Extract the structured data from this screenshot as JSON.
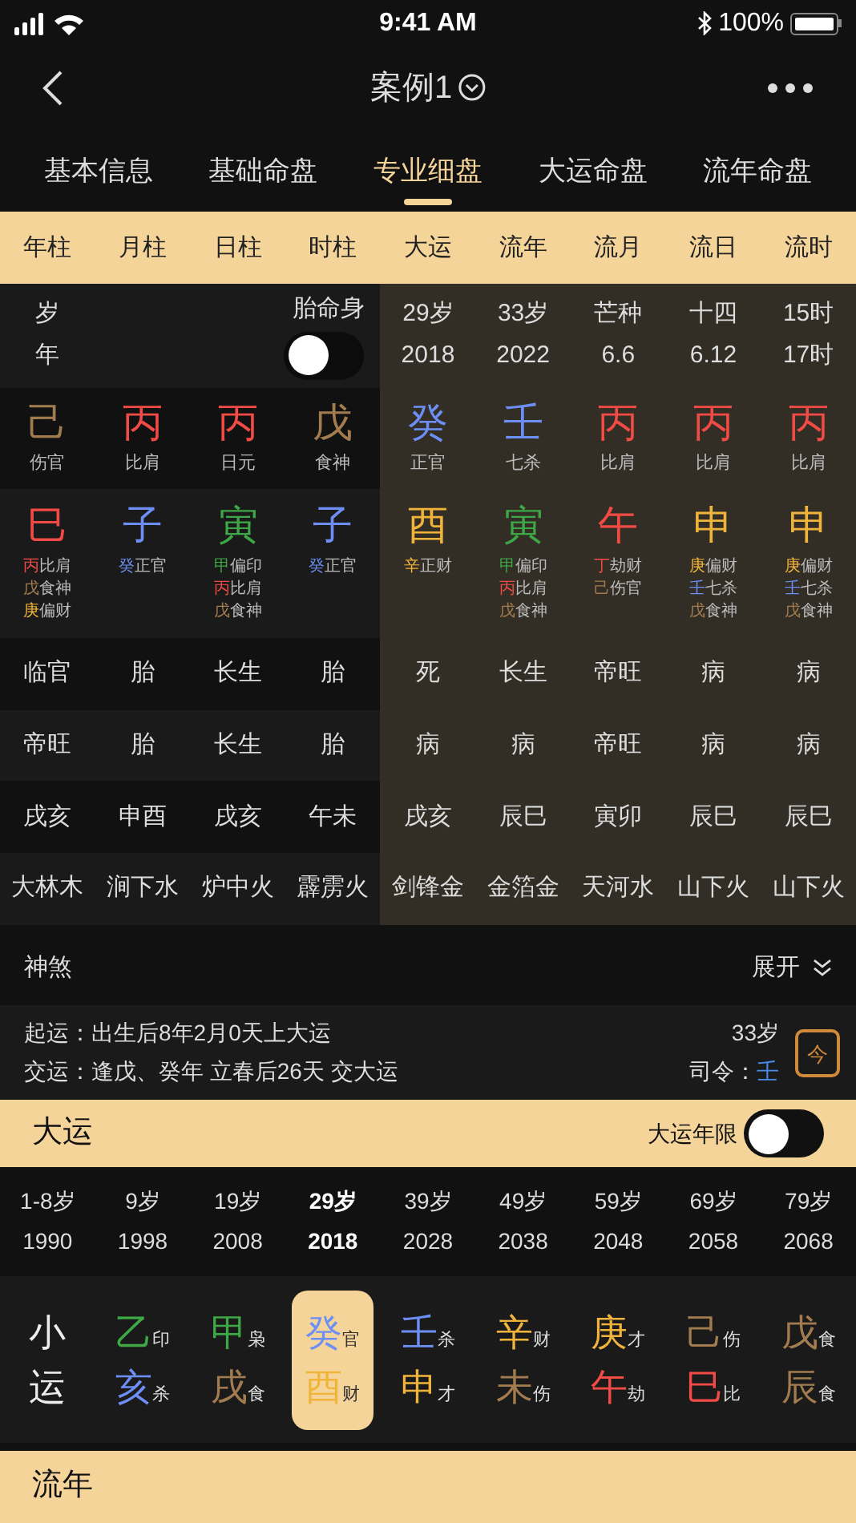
{
  "status_bar": {
    "time": "9:41 AM",
    "battery": "100%"
  },
  "nav": {
    "title": "案例1"
  },
  "tabs": [
    {
      "label": "基本信息",
      "selected": false
    },
    {
      "label": "基础命盘",
      "selected": false
    },
    {
      "label": "专业细盘",
      "selected": true
    },
    {
      "label": "大运命盘",
      "selected": false
    },
    {
      "label": "流年命盘",
      "selected": false
    }
  ],
  "columns": [
    "年柱",
    "月柱",
    "日柱",
    "时柱",
    "大运",
    "流年",
    "流月",
    "流日",
    "流时"
  ],
  "age_labels": [
    "岁",
    "年"
  ],
  "taimingshen": {
    "label": "胎命身",
    "on": false
  },
  "period_info": [
    {
      "line1": "29岁",
      "line2": "2018"
    },
    {
      "line1": "33岁",
      "line2": "2022"
    },
    {
      "line1": "芒种",
      "line2": "6.6"
    },
    {
      "line1": "十四",
      "line2": "6.12"
    },
    {
      "line1": "15时",
      "line2": "17时"
    }
  ],
  "stems": [
    {
      "char": "己",
      "color": "#a27c4f",
      "god": "伤官"
    },
    {
      "char": "丙",
      "color": "#f24b45",
      "god": "比肩"
    },
    {
      "char": "丙",
      "color": "#f24b45",
      "god": "日元"
    },
    {
      "char": "戊",
      "color": "#a27c4f",
      "god": "食神"
    },
    {
      "char": "癸",
      "color": "#6d8ff5",
      "god": "正官"
    },
    {
      "char": "壬",
      "color": "#6d8ff5",
      "god": "七杀"
    },
    {
      "char": "丙",
      "color": "#f24b45",
      "god": "比肩"
    },
    {
      "char": "丙",
      "color": "#f24b45",
      "god": "比肩"
    },
    {
      "char": "丙",
      "color": "#f24b45",
      "god": "比肩"
    }
  ],
  "branches": [
    {
      "char": "巳",
      "color": "#f24b45",
      "hidden": [
        {
          "char": "丙",
          "color": "#f24b45",
          "god": "比肩"
        },
        {
          "char": "戊",
          "color": "#a27c4f",
          "god": "食神"
        },
        {
          "char": "庚",
          "color": "#f0b43a",
          "god": "偏财"
        }
      ]
    },
    {
      "char": "子",
      "color": "#6d8ff5",
      "hidden": [
        {
          "char": "癸",
          "color": "#6d8ff5",
          "god": "正官"
        }
      ]
    },
    {
      "char": "寅",
      "color": "#3da845",
      "hidden": [
        {
          "char": "甲",
          "color": "#3da845",
          "god": "偏印"
        },
        {
          "char": "丙",
          "color": "#f24b45",
          "god": "比肩"
        },
        {
          "char": "戊",
          "color": "#a27c4f",
          "god": "食神"
        }
      ]
    },
    {
      "char": "子",
      "color": "#6d8ff5",
      "hidden": [
        {
          "char": "癸",
          "color": "#6d8ff5",
          "god": "正官"
        }
      ]
    },
    {
      "char": "酉",
      "color": "#f0b43a",
      "hidden": [
        {
          "char": "辛",
          "color": "#f0b43a",
          "god": "正财"
        }
      ]
    },
    {
      "char": "寅",
      "color": "#3da845",
      "hidden": [
        {
          "char": "甲",
          "color": "#3da845",
          "god": "偏印"
        },
        {
          "char": "丙",
          "color": "#f24b45",
          "god": "比肩"
        },
        {
          "char": "戊",
          "color": "#a27c4f",
          "god": "食神"
        }
      ]
    },
    {
      "char": "午",
      "color": "#f24b45",
      "hidden": [
        {
          "char": "丁",
          "color": "#f24b45",
          "god": "劫财"
        },
        {
          "char": "己",
          "color": "#a27c4f",
          "god": "伤官"
        }
      ]
    },
    {
      "char": "申",
      "color": "#f0b43a",
      "hidden": [
        {
          "char": "庚",
          "color": "#f0b43a",
          "god": "偏财"
        },
        {
          "char": "壬",
          "color": "#6d8ff5",
          "god": "七杀"
        },
        {
          "char": "戊",
          "color": "#a27c4f",
          "god": "食神"
        }
      ]
    },
    {
      "char": "申",
      "color": "#f0b43a",
      "hidden": [
        {
          "char": "庚",
          "color": "#f0b43a",
          "god": "偏财"
        },
        {
          "char": "壬",
          "color": "#6d8ff5",
          "god": "七杀"
        },
        {
          "char": "戊",
          "color": "#a27c4f",
          "god": "食神"
        }
      ]
    }
  ],
  "rows": [
    [
      "临官",
      "胎",
      "长生",
      "胎",
      "死",
      "长生",
      "帝旺",
      "病",
      "病"
    ],
    [
      "帝旺",
      "胎",
      "长生",
      "胎",
      "病",
      "病",
      "帝旺",
      "病",
      "病"
    ],
    [
      "戌亥",
      "申酉",
      "戌亥",
      "午未",
      "戌亥",
      "辰巳",
      "寅卯",
      "辰巳",
      "辰巳"
    ],
    [
      "大林木",
      "涧下水",
      "炉中火",
      "霹雳火",
      "剑锋金",
      "金箔金",
      "天河水",
      "山下火",
      "山下火"
    ]
  ],
  "shensha": {
    "title": "神煞",
    "toggle": "展开"
  },
  "yun_info": {
    "lines": [
      "起运：出生后8年2月0天上大运",
      "交运：逢戊、癸年 立春后26天 交大运"
    ],
    "age": "33岁",
    "siling": {
      "label": "司令：",
      "value": "壬",
      "color": "#4a8ae8"
    },
    "calendar_label": "今"
  },
  "dayun": {
    "title": "大运",
    "toggle_label": "大运年限",
    "on": false,
    "periods": [
      {
        "age": "1-8岁",
        "year": "1990",
        "selected": false
      },
      {
        "age": "9岁",
        "year": "1998",
        "selected": false
      },
      {
        "age": "19岁",
        "year": "2008",
        "selected": false
      },
      {
        "age": "29岁",
        "year": "2018",
        "selected": true
      },
      {
        "age": "39岁",
        "year": "2028",
        "selected": false
      },
      {
        "age": "49岁",
        "year": "2038",
        "selected": false
      },
      {
        "age": "59岁",
        "year": "2048",
        "selected": false
      },
      {
        "age": "69岁",
        "year": "2058",
        "selected": false
      },
      {
        "age": "79岁",
        "year": "2068",
        "selected": false
      }
    ]
  },
  "xiaoyun": {
    "label": "小运",
    "items": [
      {
        "selected": false,
        "stem": {
          "char": "乙",
          "color": "#3da845",
          "god": "印"
        },
        "branch": {
          "char": "亥",
          "color": "#6d8ff5",
          "god": "杀"
        }
      },
      {
        "selected": false,
        "stem": {
          "char": "甲",
          "color": "#3da845",
          "god": "枭"
        },
        "branch": {
          "char": "戌",
          "color": "#a27c4f",
          "god": "食"
        }
      },
      {
        "selected": true,
        "stem": {
          "char": "癸",
          "color": "#6d8ff5",
          "god": "官"
        },
        "branch": {
          "char": "酉",
          "color": "#f0b43a",
          "god": "财"
        }
      },
      {
        "selected": false,
        "stem": {
          "char": "壬",
          "color": "#6d8ff5",
          "god": "杀"
        },
        "branch": {
          "char": "申",
          "color": "#f0b43a",
          "god": "才"
        }
      },
      {
        "selected": false,
        "stem": {
          "char": "辛",
          "color": "#f0b43a",
          "god": "财"
        },
        "branch": {
          "char": "未",
          "color": "#a27c4f",
          "god": "伤"
        }
      },
      {
        "selected": false,
        "stem": {
          "char": "庚",
          "color": "#f0b43a",
          "god": "才"
        },
        "branch": {
          "char": "午",
          "color": "#f24b45",
          "god": "劫"
        }
      },
      {
        "selected": false,
        "stem": {
          "char": "己",
          "color": "#a27c4f",
          "god": "伤"
        },
        "branch": {
          "char": "巳",
          "color": "#f24b45",
          "god": "比"
        }
      },
      {
        "selected": false,
        "stem": {
          "char": "戊",
          "color": "#a27c4f",
          "god": "食"
        },
        "branch": {
          "char": "辰",
          "color": "#a27c4f",
          "god": "食"
        }
      }
    ]
  },
  "liunian": {
    "title": "流年"
  }
}
